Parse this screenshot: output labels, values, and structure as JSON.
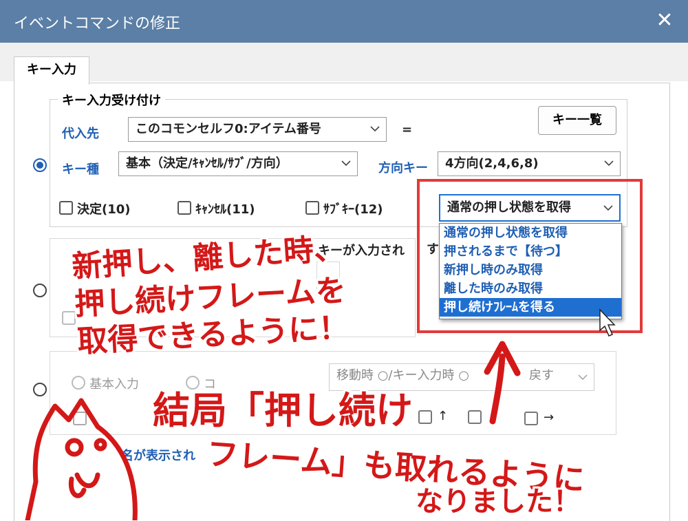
{
  "window": {
    "title": "イベントコマンドの修正"
  },
  "tabs": [
    {
      "label": "キー入力"
    }
  ],
  "group1": {
    "label": "キー入力受け付け",
    "assign_label": "代入先",
    "assign_value": "このコモンセルフ0:アイテム番号",
    "equals": "=",
    "key_list_button": "キー一覧",
    "key_type_label": "キー種",
    "key_type_value": "基本（決定/ｷｬﾝｾﾙ/ｻﾌﾞ/方向）",
    "direction_label": "方向キー",
    "direction_value": "4方向(2,4,6,8)",
    "checks": [
      {
        "label": "決定(10)"
      },
      {
        "label": "ｷｬﾝｾﾙ(11)"
      },
      {
        "label": "ｻﾌﾞｷｰ(12)"
      }
    ],
    "state_select_value": "通常の押し状態を取得",
    "state_options": [
      "通常の押し状態を取得",
      "押されるまで【待つ】",
      "新押し時のみ取得",
      "離した時のみ取得",
      "押し続けﾌﾚｰﾑを得る"
    ],
    "selected_option_index": 4
  },
  "group2": {
    "partial_text": "キーが入力され",
    "partial_text2": "す"
  },
  "group3": {
    "radio1": "基本入力",
    "radio2": "コ",
    "select_value": "移動時 ○/キー入力時 ○",
    "select_tail": "戻す",
    "up_label": "↑",
    "right_label": "→",
    "bottom_text": "名が表示され"
  },
  "annotations": {
    "top_line1": "新押し、離した時、",
    "top_line2": "押し続けフレームを",
    "top_line3": "取得できるように！",
    "bottom_line1": "結局「押し続け",
    "bottom_line2": "フレーム」も取れるように",
    "bottom_line3": "なりました！"
  },
  "colors": {
    "titlebar": "#5b7fa6",
    "accent": "#1f5fb4",
    "annotation": "#d41818",
    "highlight": "#1f6fd1"
  }
}
